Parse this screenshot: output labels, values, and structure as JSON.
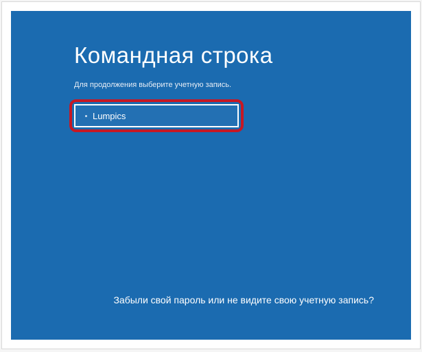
{
  "header": {
    "title": "Командная строка",
    "subtitle": "Для продолжения выберите учетную запись."
  },
  "accounts": [
    {
      "name": "Lumpics"
    }
  ],
  "footer": {
    "forgot_link": "Забыли свой пароль или не видите свою учетную запись?"
  }
}
